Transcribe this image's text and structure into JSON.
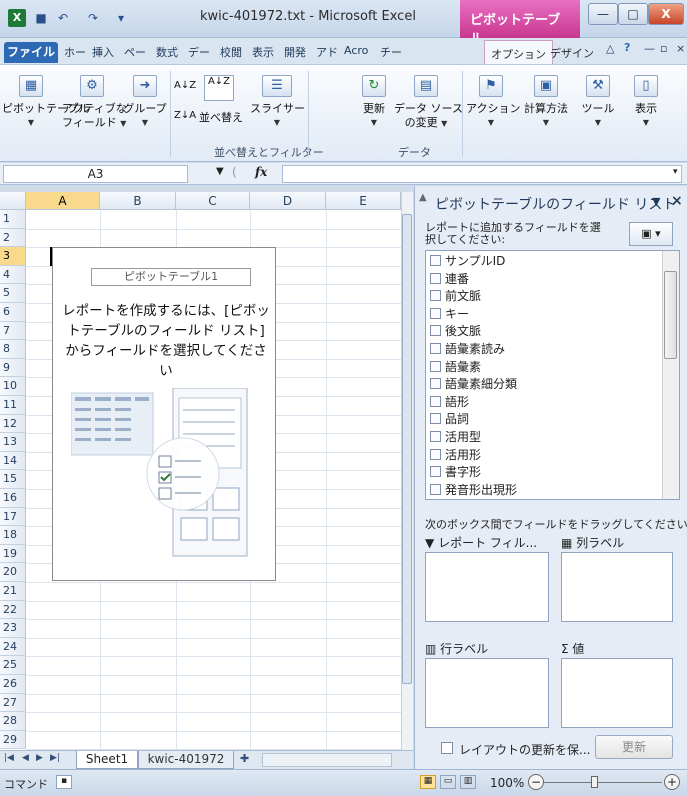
{
  "window": {
    "app_icon": "X",
    "title": "kwic-401972.txt - Microsoft Excel",
    "context_tab_title": "ピボットテーブル...",
    "minimize": "—",
    "maximize": "□",
    "close": "X"
  },
  "tabs": {
    "file": "ファイル",
    "items": [
      "ホー",
      "挿入",
      "ペー",
      "数式",
      "デー",
      "校閲",
      "表示",
      "開発",
      "アド",
      "Acro",
      "チー"
    ],
    "options": "オプション",
    "design": "デザイン"
  },
  "ribbon": {
    "pivottable": "ピボットテーブル",
    "active_field_1": "アクティブな",
    "active_field_2": "フィールド",
    "group": "グループ",
    "sort_az": "A↓Z",
    "sort": "並べ替え",
    "slicer": "スライサー",
    "refresh": "更新",
    "data_source_1": "データ ソース",
    "data_source_2": "の変更",
    "actions": "アクション",
    "calc": "計算方法",
    "tools": "ツール",
    "show": "表示",
    "group_sort": "並べ替えとフィルター",
    "group_data": "データ"
  },
  "formula_bar": {
    "name_box": "A3",
    "fx": "fx",
    "value": ""
  },
  "sheet": {
    "columns": [
      "A",
      "B",
      "C",
      "D",
      "E"
    ],
    "rows": [
      "1",
      "2",
      "3",
      "4",
      "5",
      "6",
      "7",
      "8",
      "9",
      "10",
      "11",
      "12",
      "13",
      "14",
      "15",
      "16",
      "17",
      "18",
      "19",
      "20",
      "21",
      "22",
      "23",
      "24",
      "25",
      "26",
      "27",
      "28",
      "29"
    ],
    "selected_row": "3",
    "selected_column": "A",
    "pivot_placeholder": "ピボットテーブル1",
    "pivot_message": "レポートを作成するには、[ピボットテーブルのフィールド リスト] からフィールドを選択してください"
  },
  "sheet_tabs": {
    "active": "Sheet1",
    "other": "kwic-401972"
  },
  "status": {
    "mode": "コマンド",
    "zoom": "100%"
  },
  "pane": {
    "title": "ピボットテーブルのフィールド リスト",
    "hint": "レポートに追加するフィールドを選択してください:",
    "fields": [
      "サンプルID",
      "連番",
      "前文脈",
      "キー",
      "後文脈",
      "語彙素読み",
      "語彙素",
      "語彙素細分類",
      "語形",
      "品詞",
      "活用型",
      "活用形",
      "書字形",
      "発音形出現形"
    ],
    "drag_hint": "次のボックス間でフィールドをドラッグしてください:",
    "area_filter": "レポート フィル...",
    "area_columns": "列ラベル",
    "area_rows": "行ラベル",
    "area_values": "値",
    "defer_update": "レイアウトの更新を保...",
    "update_button": "更新"
  }
}
